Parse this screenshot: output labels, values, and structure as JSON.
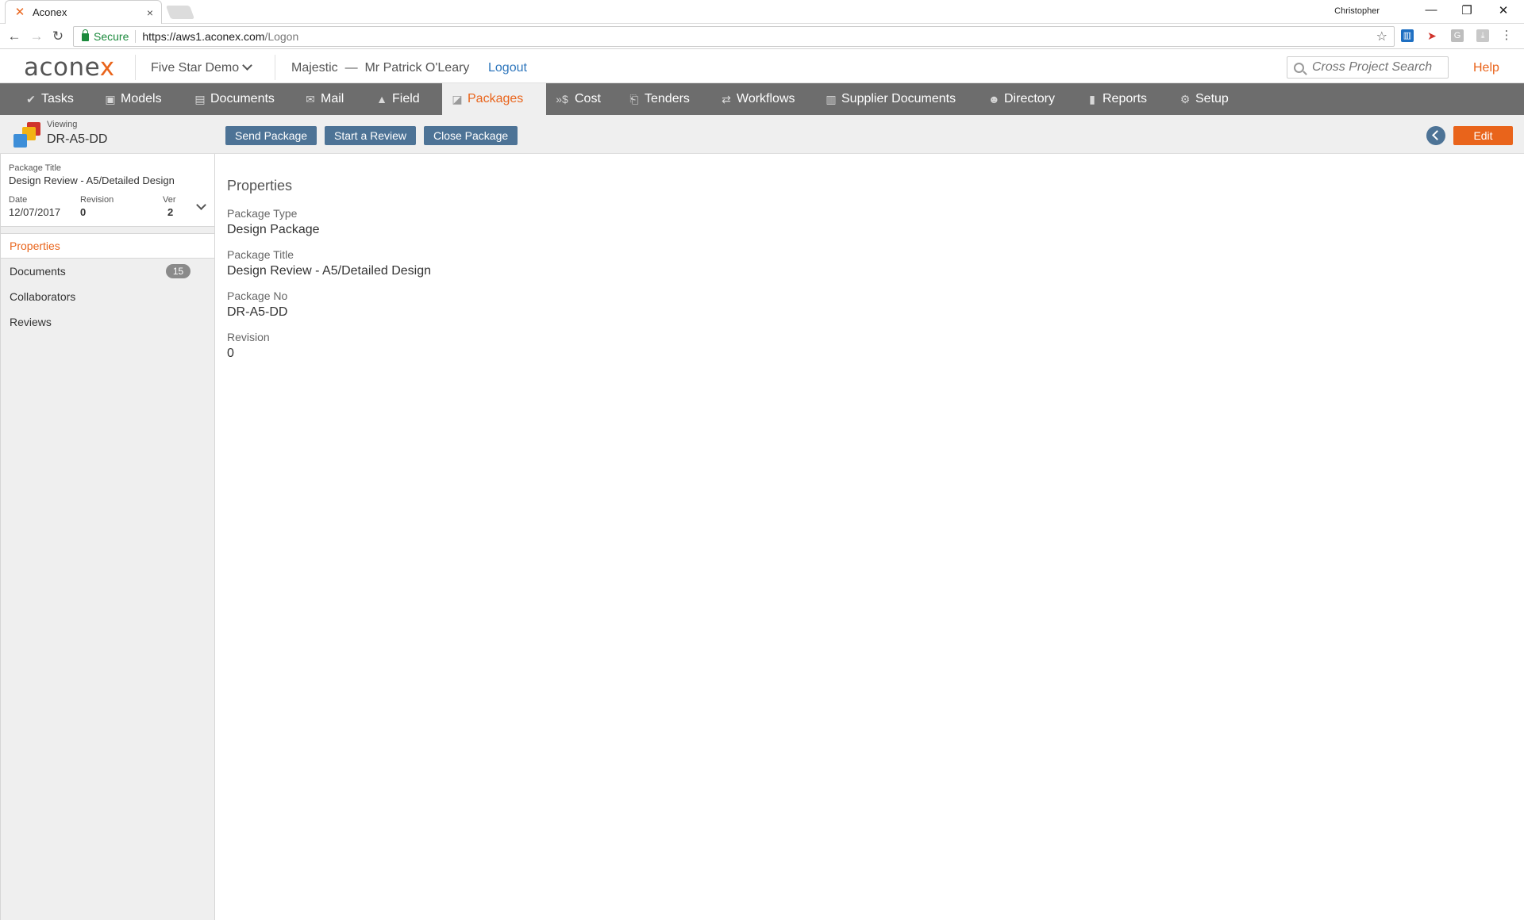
{
  "browser": {
    "tab_title": "Aconex",
    "tab_close": "×",
    "user": "Christopher",
    "secure_label": "Secure",
    "url_host": "https://aws1.aconex.com",
    "url_path": "/Logon"
  },
  "header": {
    "logo_main": "acone",
    "logo_accent": "x",
    "project": "Five Star Demo",
    "organization": "Majestic  —  Mr Patrick O'Leary",
    "logout": "Logout",
    "search_placeholder": "Cross Project Search",
    "help": "Help"
  },
  "nav": {
    "items": [
      {
        "label": "Tasks",
        "icon": "✔"
      },
      {
        "label": "Models",
        "icon": "▣"
      },
      {
        "label": "Documents",
        "icon": "▤"
      },
      {
        "label": "Mail",
        "icon": "✉"
      },
      {
        "label": "Field",
        "icon": "▲"
      },
      {
        "label": "Packages",
        "icon": "◪"
      },
      {
        "label": "Cost",
        "icon": "»$"
      },
      {
        "label": "Tenders",
        "icon": "⎗"
      },
      {
        "label": "Workflows",
        "icon": "⇄"
      },
      {
        "label": "Supplier Documents",
        "icon": "▥"
      },
      {
        "label": "Directory",
        "icon": "☻"
      },
      {
        "label": "Reports",
        "icon": "▮"
      },
      {
        "label": "Setup",
        "icon": "⚙"
      }
    ],
    "active": "Packages"
  },
  "toolbar": {
    "viewing_label": "Viewing",
    "viewing_id": "DR-A5-DD",
    "send_package": "Send Package",
    "start_review": "Start a Review",
    "close_package": "Close Package",
    "edit": "Edit"
  },
  "summary": {
    "title_label": "Package Title",
    "title_value": "Design Review - A5/Detailed Design",
    "date_label": "Date",
    "date_value": "12/07/2017",
    "revision_label": "Revision",
    "revision_value": "0",
    "ver_label": "Ver",
    "ver_value": "2"
  },
  "sidebar": {
    "items": [
      {
        "label": "Properties",
        "active": true
      },
      {
        "label": "Documents",
        "count": "15"
      },
      {
        "label": "Collaborators"
      },
      {
        "label": "Reviews"
      }
    ]
  },
  "properties": {
    "section_title": "Properties",
    "fields": [
      {
        "label": "Package Type",
        "value": "Design Package"
      },
      {
        "label": "Package Title",
        "value": "Design Review - A5/Detailed Design"
      },
      {
        "label": "Package No",
        "value": "DR-A5-DD"
      },
      {
        "label": "Revision",
        "value": "0"
      }
    ]
  },
  "colors": {
    "accent": "#e9641b",
    "nav_bg": "#6d6d6d",
    "button": "#4d7396",
    "link": "#2e76bc"
  }
}
